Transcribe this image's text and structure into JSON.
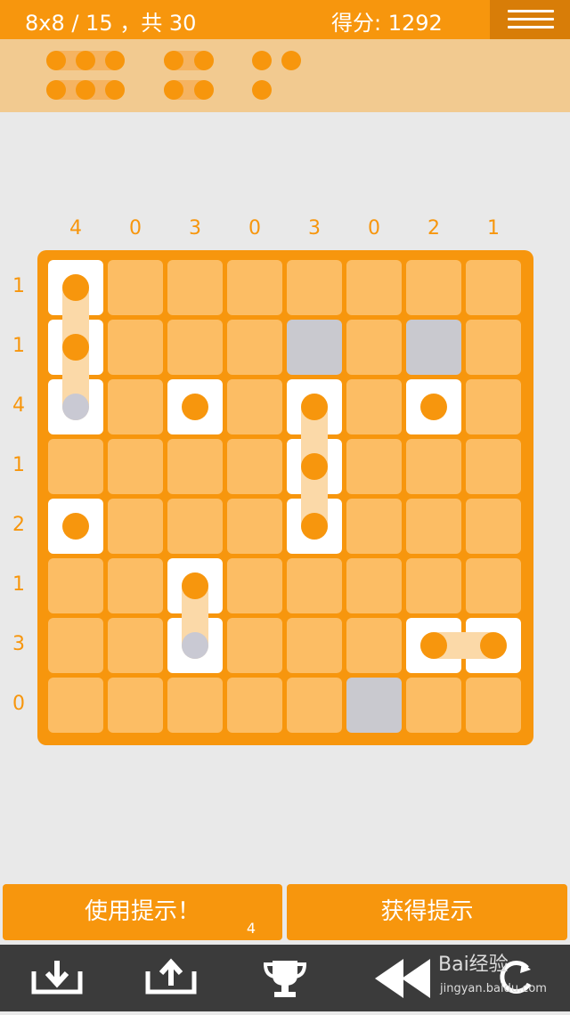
{
  "header": {
    "level": "8x8 / 15 ，共 30",
    "score": "得分: 1292"
  },
  "icons": {
    "menu": "menu-icon",
    "download": "download-icon",
    "upload": "upload-icon",
    "trophy": "trophy-icon",
    "rewind": "rewind-icon",
    "refresh": "refresh-icon"
  },
  "colors": {
    "accent": "#f7960d",
    "cell_empty": "#fcbd64",
    "cell_filled": "#ffffff",
    "cell_blocked": "#c9c9cf",
    "legend_bg": "#f2ca90",
    "toolbar": "#3b3b3b",
    "background": "#e9e9e9"
  },
  "board": {
    "column_clues": [
      "4",
      "0",
      "3",
      "0",
      "3",
      "0",
      "2",
      "1"
    ],
    "row_clues": [
      "1",
      "1",
      "4",
      "1",
      "2",
      "1",
      "3",
      "0"
    ]
  },
  "actions": {
    "use_hint": "使用提示！",
    "hint_count": "4",
    "get_hint": "获得提示"
  },
  "watermark": {
    "brand": "Bai经验",
    "url": "jingyan.baidu.com"
  }
}
